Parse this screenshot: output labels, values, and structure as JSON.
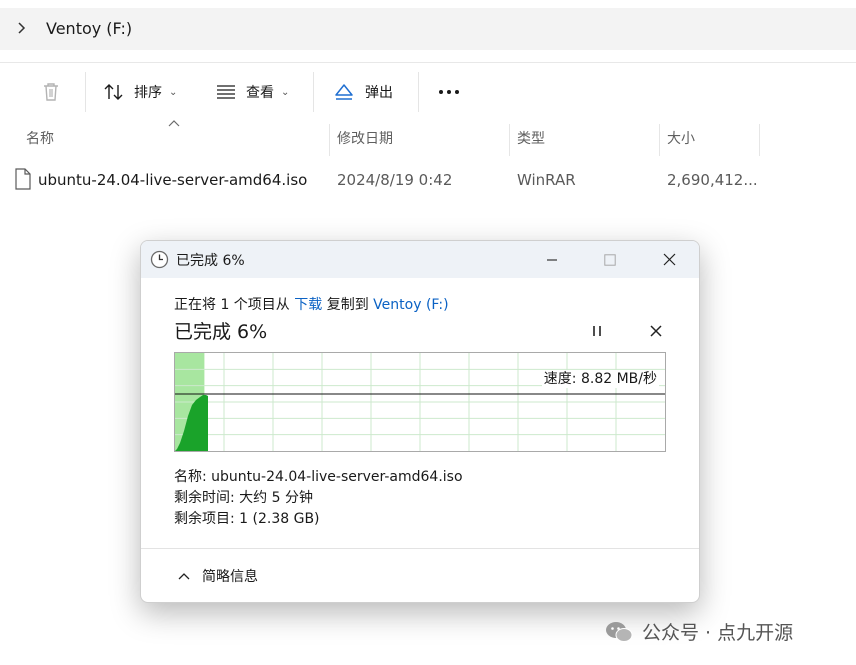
{
  "address_bar": {
    "path": "Ventoy (F:)"
  },
  "toolbar": {
    "sort_label": "排序",
    "view_label": "查看",
    "eject_label": "弹出"
  },
  "columns": {
    "name": "名称",
    "date": "修改日期",
    "type": "类型",
    "size": "大小"
  },
  "file": {
    "name": "ubuntu-24.04-live-server-amd64.iso",
    "date": "2024/8/19 0:42",
    "type": "WinRAR",
    "size": "2,690,412..."
  },
  "dialog": {
    "title": "已完成 6%",
    "line_prefix": "正在将 1 个项目从 ",
    "line_source": "下载",
    "line_mid": " 复制到 ",
    "line_dest": "Ventoy (F:)",
    "progress_label": "已完成 6%",
    "progress_percent": 6,
    "speed": "速度: 8.82 MB/秒",
    "name_label": "名称: ubuntu-24.04-live-server-amd64.iso",
    "time_left": "剩余时间: 大约 5 分钟",
    "items_left": "剩余项目: 1 (2.38 GB)",
    "details_toggle": "简略信息"
  },
  "watermark": "公众号 · 点九开源",
  "colors": {
    "accent": "#0b62c4",
    "graph_fill": "#1aa32a",
    "graph_done": "#a8e6a0",
    "grid": "#cde9cd"
  }
}
